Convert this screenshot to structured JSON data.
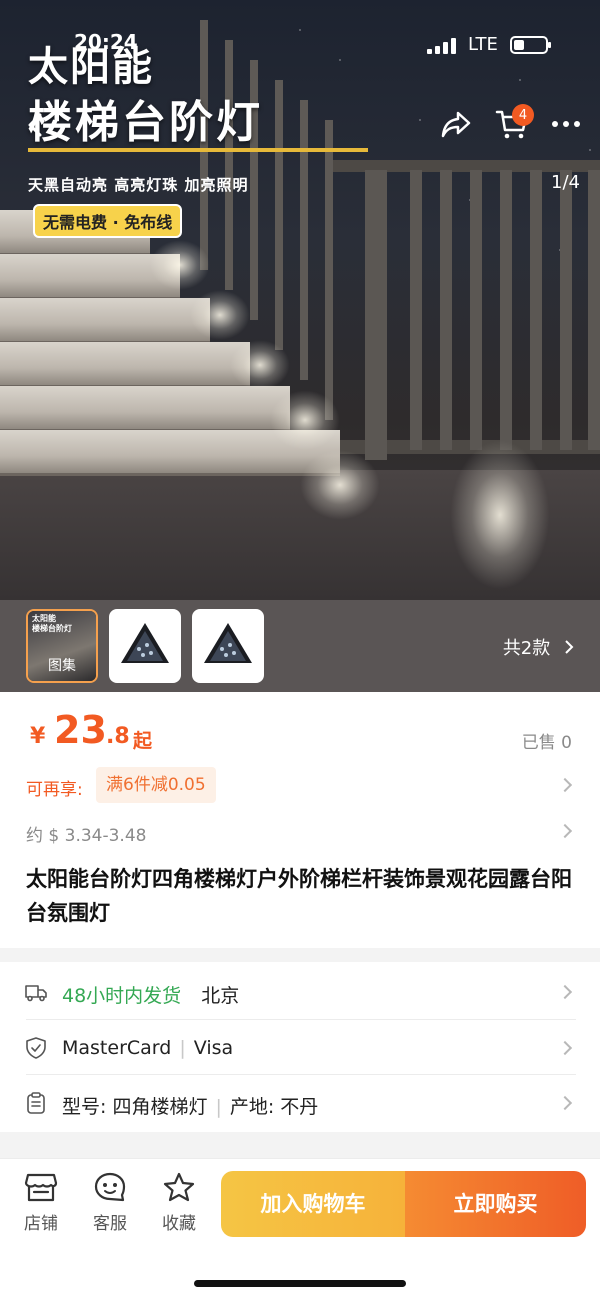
{
  "status_bar": {
    "time": "20:24",
    "network": "LTE"
  },
  "nav": {
    "cart_count": "4"
  },
  "hero": {
    "title_line1": "太阳能",
    "title_line2": "楼梯台阶灯",
    "tagline": "天黑自动亮 高亮灯珠 加亮照明",
    "pill": "无需电费 · 免布线",
    "counter": "1/4"
  },
  "thumbnails": {
    "first_label": "图集",
    "first_overlay_line1": "太阳能",
    "first_overlay_line2": "楼梯台阶灯",
    "more_label": "共2款"
  },
  "price": {
    "currency": "¥",
    "integer": "23",
    "decimal": ".8",
    "suffix": "起",
    "sold": "已售 0",
    "promo_label": "可再享:",
    "promo_tag": "满6件减0.05",
    "usd_range": "约 $ 3.34-3.48"
  },
  "product": {
    "title": "太阳能台阶灯四角楼梯灯户外阶梯栏杆装饰景观花园露台阳台氛围灯"
  },
  "info": {
    "shipping_time": "48小时内发货",
    "shipping_from": "北京",
    "payment_1": "MasterCard",
    "payment_2": "Visa",
    "model": "型号: 四角楼梯灯",
    "origin": "产地: 不丹"
  },
  "bottom_bar": {
    "shop": "店铺",
    "service": "客服",
    "favorite": "收藏",
    "add_to_cart": "加入购物车",
    "buy_now": "立即购买"
  },
  "colors": {
    "accent_orange": "#f25a22",
    "cart_yellow": "#f5c544",
    "green": "#34a853",
    "hero_underline": "#e6b93a"
  }
}
